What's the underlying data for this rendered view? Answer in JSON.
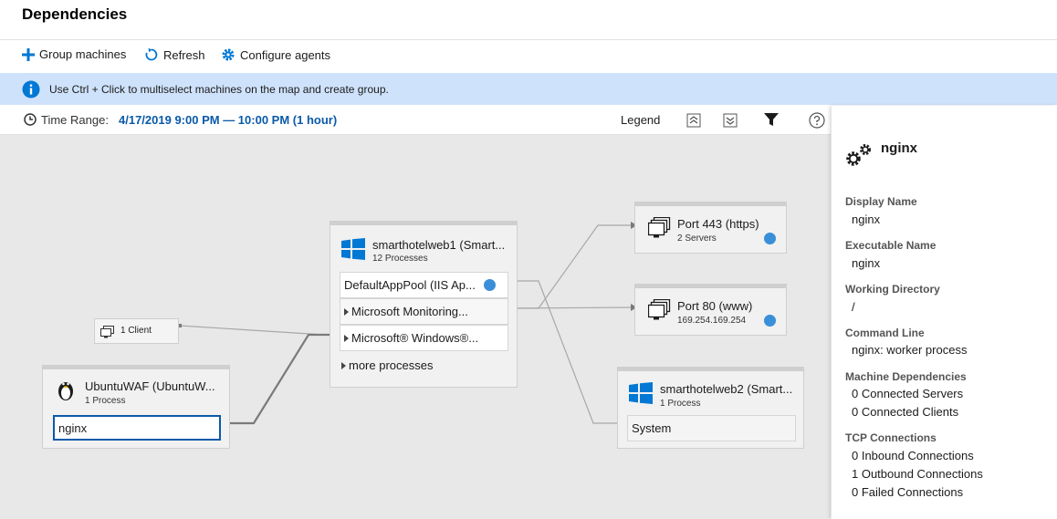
{
  "title": "Dependencies",
  "toolbar": {
    "group_machines": "Group machines",
    "refresh": "Refresh",
    "configure_agents": "Configure agents"
  },
  "info_bar": {
    "text": "Use Ctrl + Click to multiselect machines on the map and create group."
  },
  "time_range": {
    "label": "Time Range:",
    "value": "4/17/2019 9:00 PM — 10:00 PM (1 hour)"
  },
  "map_toolbar": {
    "legend": "Legend"
  },
  "colors": {
    "accent": "#0078d4",
    "info_bg": "#cfe2fb",
    "map_bg": "#e8e8e8"
  },
  "map": {
    "client": {
      "label": "1 Client"
    },
    "ubuntu": {
      "name": "UbuntuWAF (UbuntuW...",
      "sub": "1 Process",
      "process": "nginx"
    },
    "web1": {
      "name": "smarthotelweb1 (Smart...",
      "sub": "12 Processes",
      "processes": [
        "DefaultAppPool (IIS Ap...",
        "Microsoft Monitoring...",
        "Microsoft® Windows®..."
      ],
      "more": "more processes"
    },
    "port443": {
      "name": "Port 443 (https)",
      "sub": "2 Servers"
    },
    "port80": {
      "name": "Port 80 (www)",
      "sub": "169.254.169.254"
    },
    "web2": {
      "name": "smarthotelweb2 (Smart...",
      "sub": "1 Process",
      "process": "System"
    }
  },
  "panel": {
    "title": "nginx",
    "display_name_label": "Display Name",
    "display_name": "nginx",
    "executable_name_label": "Executable Name",
    "executable_name": "nginx",
    "working_directory_label": "Working Directory",
    "working_directory": "/",
    "command_line_label": "Command Line",
    "command_line": "nginx: worker process",
    "machine_deps_label": "Machine Dependencies",
    "connected_servers": "0 Connected Servers",
    "connected_clients": "0 Connected Clients",
    "tcp_label": "TCP Connections",
    "inbound": "0 Inbound Connections",
    "outbound": "1 Outbound Connections",
    "failed": "0 Failed Connections"
  }
}
